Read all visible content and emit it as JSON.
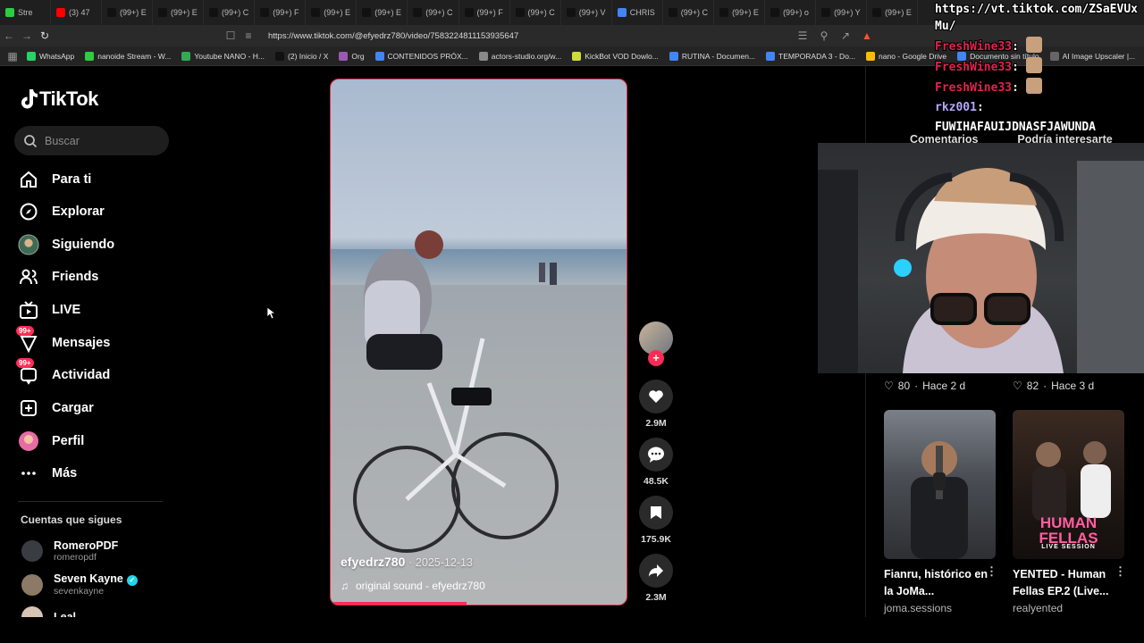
{
  "browser": {
    "tabs": [
      {
        "label": "Stre",
        "color": "#2ecc40"
      },
      {
        "label": "(3) 47",
        "color": "#ff0000"
      },
      {
        "label": "(99+) E",
        "color": "#111"
      },
      {
        "label": "(99+) E",
        "color": "#111"
      },
      {
        "label": "(99+) C",
        "color": "#111"
      },
      {
        "label": "(99+) F",
        "color": "#111"
      },
      {
        "label": "(99+) E",
        "color": "#111"
      },
      {
        "label": "(99+) E",
        "color": "#111"
      },
      {
        "label": "(99+) C",
        "color": "#111"
      },
      {
        "label": "(99+) F",
        "color": "#111"
      },
      {
        "label": "(99+) C",
        "color": "#111"
      },
      {
        "label": "(99+) V",
        "color": "#111"
      },
      {
        "label": "CHRIS",
        "color": "#4285f4"
      },
      {
        "label": "(99+) C",
        "color": "#111"
      },
      {
        "label": "(99+) E",
        "color": "#111"
      },
      {
        "label": "(99+) o",
        "color": "#111"
      },
      {
        "label": "(99+) Y",
        "color": "#111"
      },
      {
        "label": "(99+) E",
        "color": "#111"
      }
    ],
    "url": "https://www.tiktok.com/@efyedrz780/video/7583224811153935647",
    "bookmarks": [
      {
        "label": "WhatsApp",
        "color": "#25d366"
      },
      {
        "label": "nanoide Stream - W...",
        "color": "#2ecc40"
      },
      {
        "label": "Youtube NANO - H...",
        "color": "#34a853"
      },
      {
        "label": "(2) Inicio / X",
        "color": "#111"
      },
      {
        "label": "Org",
        "color": "#9b59b6"
      },
      {
        "label": "CONTENIDOS PRÓX...",
        "color": "#4285f4"
      },
      {
        "label": "actors-studio.org/w...",
        "color": "#888"
      },
      {
        "label": "KickBot VOD Dowlo...",
        "color": "#cddc39"
      },
      {
        "label": "RUTINA - Documen...",
        "color": "#4285f4"
      },
      {
        "label": "TEMPORADA 3 - Do...",
        "color": "#4285f4"
      },
      {
        "label": "nano - Google Drive",
        "color": "#fbbc05"
      },
      {
        "label": "Documento sin título",
        "color": "#4285f4"
      },
      {
        "label": "AI Image Upscaler |...",
        "color": "#666"
      }
    ]
  },
  "app": {
    "logo": "TikTok",
    "search_placeholder": "Buscar"
  },
  "nav": {
    "items": [
      {
        "label": "Para ti",
        "icon": "home-icon"
      },
      {
        "label": "Explorar",
        "icon": "compass-icon"
      },
      {
        "label": "Siguiendo",
        "icon": "following-avatar-icon"
      },
      {
        "label": "Friends",
        "icon": "friends-icon"
      },
      {
        "label": "LIVE",
        "icon": "live-icon"
      },
      {
        "label": "Mensajes",
        "icon": "messages-icon",
        "badge": "99+"
      },
      {
        "label": "Actividad",
        "icon": "activity-icon",
        "badge": "99+"
      },
      {
        "label": "Cargar",
        "icon": "upload-icon"
      },
      {
        "label": "Perfil",
        "icon": "profile-icon"
      },
      {
        "label": "Más",
        "icon": "more-icon"
      }
    ],
    "following_title": "Cuentas que sigues",
    "accounts": [
      {
        "name": "RomeroPDF",
        "handle": "romeropdf",
        "verified": false
      },
      {
        "name": "Seven Kayne",
        "handle": "sevenkayne",
        "verified": true
      },
      {
        "name": "Leal",
        "handle": "",
        "verified": false
      }
    ]
  },
  "video": {
    "author": "efyedrz780",
    "date": "2025-12-13",
    "sound": "original sound - efyedrz780",
    "progress": 0.46
  },
  "actions": {
    "likes": "2.9M",
    "comments": "48.5K",
    "saves": "175.9K",
    "shares": "2.3M"
  },
  "panel": {
    "tabs": [
      "Comentarios",
      "Podría interesarte"
    ],
    "prev_likes": [
      {
        "likes": "80",
        "ago": "Hace 2 d"
      },
      {
        "likes": "82",
        "ago": "Hace 3 d"
      }
    ],
    "recommendations": [
      {
        "title": "Fianru, histórico en la JoMa...",
        "author": "joma.sessions"
      },
      {
        "title": "YENTED - Human Fellas EP.2 (Live...",
        "author": "realyented"
      }
    ],
    "thumb2_text": "HUMAN FELLAS",
    "thumb2_sub": "LIVE SESSION"
  },
  "chat": {
    "header_line1": "https://vt.tiktok.com/ZSaEVUx",
    "header_line2": "Mu/",
    "messages": [
      {
        "user": "FreshWine33",
        "text": ""
      },
      {
        "user": "FreshWine33",
        "text": ""
      },
      {
        "user": "FreshWine33",
        "text": ""
      },
      {
        "user": "rkz001",
        "text": ""
      }
    ],
    "shout": "FUWIHAFAUIJDNASFJAWUNDA"
  }
}
